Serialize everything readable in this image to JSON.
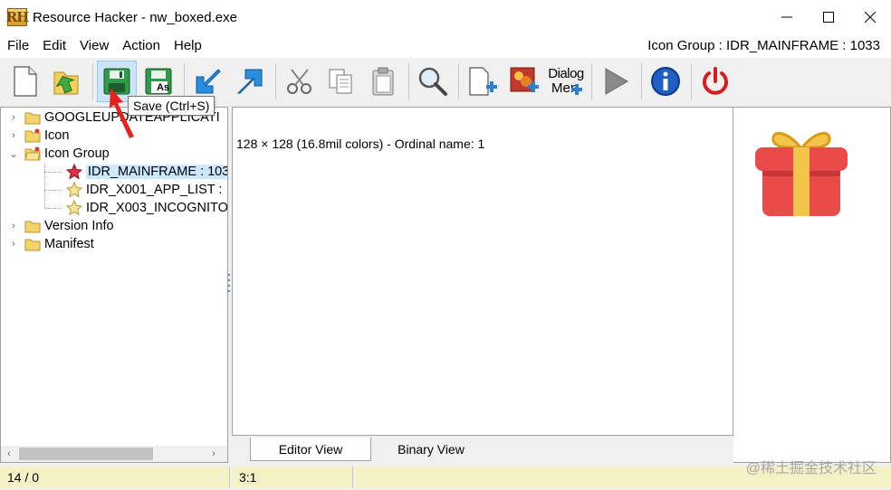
{
  "window": {
    "title": "Resource Hacker - nw_boxed.exe",
    "logo_text": "RH"
  },
  "menu": {
    "items": [
      "File",
      "Edit",
      "View",
      "Action",
      "Help"
    ],
    "status": "Icon Group : IDR_MAINFRAME : 1033"
  },
  "toolbar": {
    "tooltip": "Save (Ctrl+S)",
    "dialog_menu_label_1": "Dialog",
    "dialog_menu_label_2": "Mer",
    "save_as_label": "As"
  },
  "tree": {
    "items": [
      {
        "label": "GOOGLEUPDATEAPPLICATI",
        "expander": "›"
      },
      {
        "label": "Icon",
        "expander": "›"
      },
      {
        "label": "Icon Group",
        "expander": "⌄"
      },
      {
        "label": "IDR_MAINFRAME : 103"
      },
      {
        "label": "IDR_X001_APP_LIST :"
      },
      {
        "label": "IDR_X003_INCOGNITO"
      },
      {
        "label": "Version Info",
        "expander": "›"
      },
      {
        "label": "Manifest",
        "expander": "›"
      }
    ]
  },
  "editor": {
    "info": "128 × 128 (16.8mil colors) - Ordinal name: 1"
  },
  "tabs": {
    "editor_view": "Editor View",
    "binary_view": "Binary View"
  },
  "status": {
    "left": "14 / 0",
    "position": "3:1"
  },
  "watermark": "@稀土掘金技术社区",
  "colors": {
    "accent_active": "#cce4f7",
    "status_bg": "#f5f1c6",
    "gift_red": "#e94b4b",
    "gift_ribbon": "#f5c44b"
  }
}
